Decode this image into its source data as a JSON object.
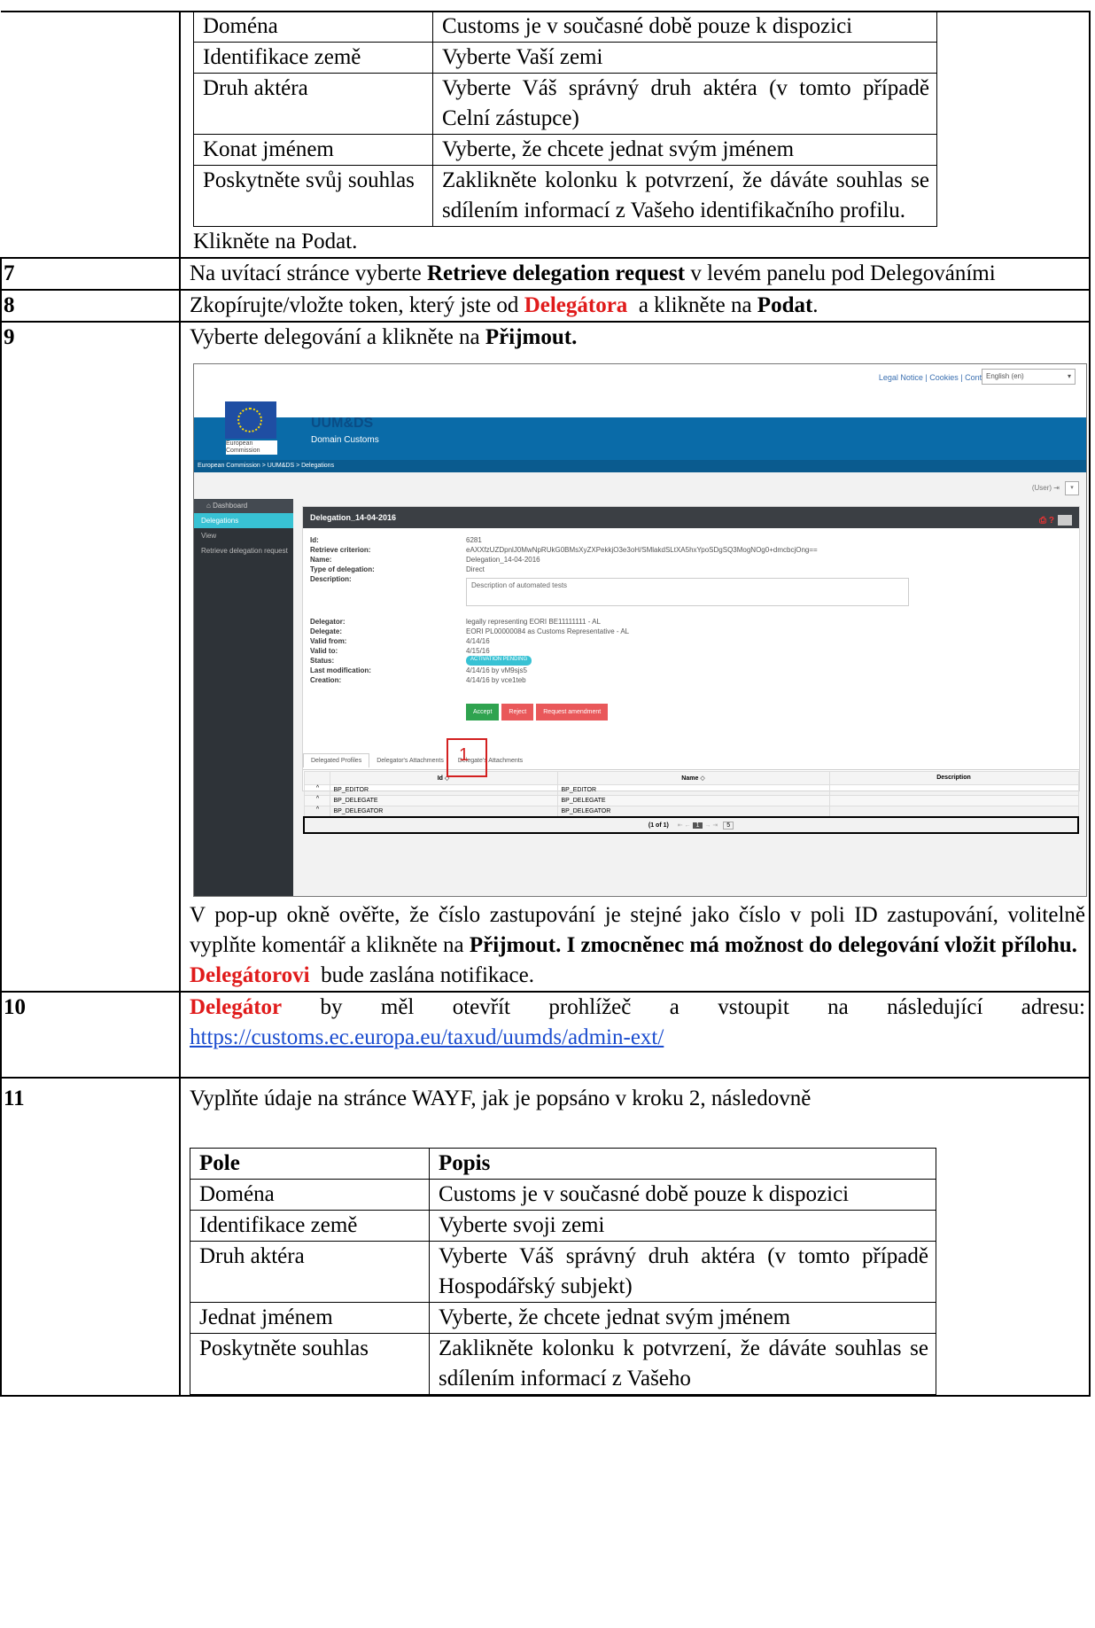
{
  "top_fields": [
    {
      "field": "Doména",
      "desc": "Customs je v současné době pouze k dispozici"
    },
    {
      "field": "Identifikace země",
      "desc": "Vyberte Vaší zemi"
    },
    {
      "field": "Druh aktéra",
      "desc": "Vyberte Váš správný druh aktéra (v tomto případě Celní zástupce)"
    },
    {
      "field": "Konat jménem",
      "desc": "Vyberte, že chcete jednat svým jménem"
    },
    {
      "field": "Poskytněte svůj souhlas",
      "desc": "Zaklikněte kolonku k potvrzení, že dáváte souhlas se sdílením informací z Vašeho identifikačního profilu."
    }
  ],
  "top_after": "Klikněte na Podat.",
  "step7": {
    "num": "7",
    "pre": "Na uvítací stránce vyberte ",
    "bold": "Retrieve delegation request",
    "post": " v levém panelu pod Delegováními"
  },
  "step8": {
    "num": "8",
    "pre": "Zkopírujte/vložte token, který jste od ",
    "red": "Delegátora",
    "mid": "  a klikněte na ",
    "bold": "Podat",
    "post": "."
  },
  "step9": {
    "num": "9",
    "pre": "Vyberte delegování a klikněte na ",
    "bold": "Přijmout.",
    "after_pre": "V pop-up okně ověřte, že číslo zastupování je stejné jako číslo v poli ID zastupování, volitelně vyplňte komentář a klikněte na ",
    "after_bold": "Přijmout. I zmocněnec má možnost do delegování vložit přílohu.",
    "notify_red": "Delegátorovi",
    "notify_post": "  bude zaslána notifikace."
  },
  "screenshot": {
    "top_links": "Legal Notice | Cookies | Contact | Search",
    "language": "English (en)",
    "eu_caption": "European Commission",
    "app_title": "UUM&DS",
    "app_subtitle": "Domain Customs",
    "breadcrumb": "European Commission > UUM&DS > Delegations",
    "user": "(User)",
    "side_head": "Dashboard",
    "side_items": [
      "Delegations",
      "View",
      "Retrieve delegation request"
    ],
    "panel_title": "Delegation_14-04-2016",
    "fields": [
      {
        "label": "Id:",
        "value": "6281"
      },
      {
        "label": "Retrieve criterion:",
        "value": "eAXXfzUZDpnlJ0MwNpRUkG0BMsXyZXPekkjO3e3oH/SMlakdSLtXA5hxYpoSDgSQ3MogNOg0+dmcbcjOng=="
      },
      {
        "label": "Name:",
        "value": "Delegation_14-04-2016"
      },
      {
        "label": "Type of delegation:",
        "value": "Direct"
      },
      {
        "label": "Description:",
        "value": "Description of automated tests"
      }
    ],
    "fields2": [
      {
        "label": "Delegator:",
        "value": "legally representing EORI BE11111111 - AL"
      },
      {
        "label": "Delegate:",
        "value": "EORI PL00000084 as Customs Representative - AL"
      },
      {
        "label": "Valid from:",
        "value": "4/14/16"
      },
      {
        "label": "Valid to:",
        "value": "4/15/16"
      },
      {
        "label": "Status:",
        "value": "ACTIVATION PENDING"
      },
      {
        "label": "Last modification:",
        "value": "4/14/16 by vM9sjs5"
      },
      {
        "label": "Creation:",
        "value": "4/14/16 by vce1teb"
      }
    ],
    "buttons": {
      "accept": "Accept",
      "reject": "Reject",
      "amend": "Request amendment"
    },
    "tabs": [
      "Delegated Profiles",
      "Delegator's Attachments",
      "Delegate's Attachments"
    ],
    "grid_headers": [
      "Id",
      "Name",
      "Description"
    ],
    "grid_rows": [
      [
        "BP_EDITOR",
        "BP_EDITOR",
        ""
      ],
      [
        "BP_DELEGATE",
        "BP_DELEGATE",
        ""
      ],
      [
        "BP_DELEGATOR",
        "BP_DELEGATOR",
        ""
      ]
    ],
    "pager": "(1 of 1)",
    "page_num": "1",
    "page_size": "5",
    "callout": "1"
  },
  "step10": {
    "num": "10",
    "red": "Delegátor",
    "pre": " by měl otevřít prohlížeč a vstoupit na následující adresu: ",
    "url": "https://customs.ec.europa.eu/taxud/uumds/admin-ext/"
  },
  "step11": {
    "num": "11",
    "text": "Vyplňte údaje na stránce WAYF, jak je popsáno v kroku 2, následovně",
    "head_field": "Pole",
    "head_desc": "Popis",
    "rows": [
      {
        "field": "Doména",
        "desc": "Customs je v současné době pouze k dispozici"
      },
      {
        "field": "Identifikace země",
        "desc": "Vyberte svoji zemi"
      },
      {
        "field": "Druh aktéra",
        "desc": "Vyberte Váš správný druh aktéra (v tomto případě Hospodářský subjekt)"
      },
      {
        "field": "Jednat jménem",
        "desc": "Vyberte, že chcete jednat svým jménem"
      },
      {
        "field": "Poskytněte souhlas",
        "desc": "Zaklikněte kolonku k potvrzení, že dáváte souhlas se sdílením informací z Vašeho"
      }
    ]
  }
}
